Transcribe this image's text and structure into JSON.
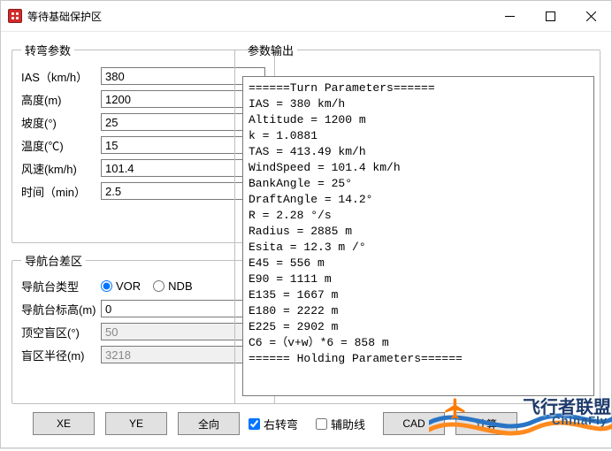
{
  "window": {
    "title": "等待基础保护区"
  },
  "turnParams": {
    "legend": "转弯参数",
    "ias": {
      "label": "IAS（km/h）",
      "value": "380"
    },
    "alt": {
      "label": "高度(m)",
      "value": "1200"
    },
    "bank": {
      "label": "坡度(°)",
      "value": "25"
    },
    "temp": {
      "label": "温度(℃)",
      "value": "15"
    },
    "wind": {
      "label": "风速(km/h)",
      "value": "101.4"
    },
    "time": {
      "label": "时间（min）",
      "value": "2.5"
    }
  },
  "navError": {
    "legend": "导航台差区",
    "type": {
      "label": "导航台类型",
      "opt1": "VOR",
      "opt2": "NDB",
      "selected": "VOR"
    },
    "elev": {
      "label": "导航台标高(m)",
      "value": "0"
    },
    "cone": {
      "label": "顶空盲区(°)",
      "value": "50",
      "disabled": true
    },
    "radius": {
      "label": "盲区半径(m)",
      "value": "3218",
      "disabled": true
    }
  },
  "buttons": {
    "xe": "XE",
    "ye": "YE",
    "omni": "全向",
    "cad": "CAD",
    "calc": "计算"
  },
  "checks": {
    "rightTurn": {
      "label": "右转弯",
      "checked": true
    },
    "aux": {
      "label": "辅助线",
      "checked": false
    }
  },
  "output": {
    "legend": "参数输出",
    "lines": [
      "======Turn Parameters======",
      "IAS = 380 km/h",
      "Altitude = 1200 m",
      "k = 1.0881",
      "TAS = 413.49 km/h",
      "WindSpeed = 101.4 km/h",
      "BankAngle = 25°",
      "DraftAngle = 14.2°",
      "R = 2.28 °/s",
      "Radius = 2885 m",
      "Esita = 12.3 m /°",
      "E45 = 556 m",
      "E90 = 1111 m",
      "E135 = 1667 m",
      "E180 = 2222 m",
      "E225 = 2902 m",
      "C6 =（v+w）*6 = 858 m",
      "====== Holding Parameters======"
    ]
  },
  "overlay": {
    "text1": "飞行者联盟",
    "text2": "ChinaFly"
  }
}
